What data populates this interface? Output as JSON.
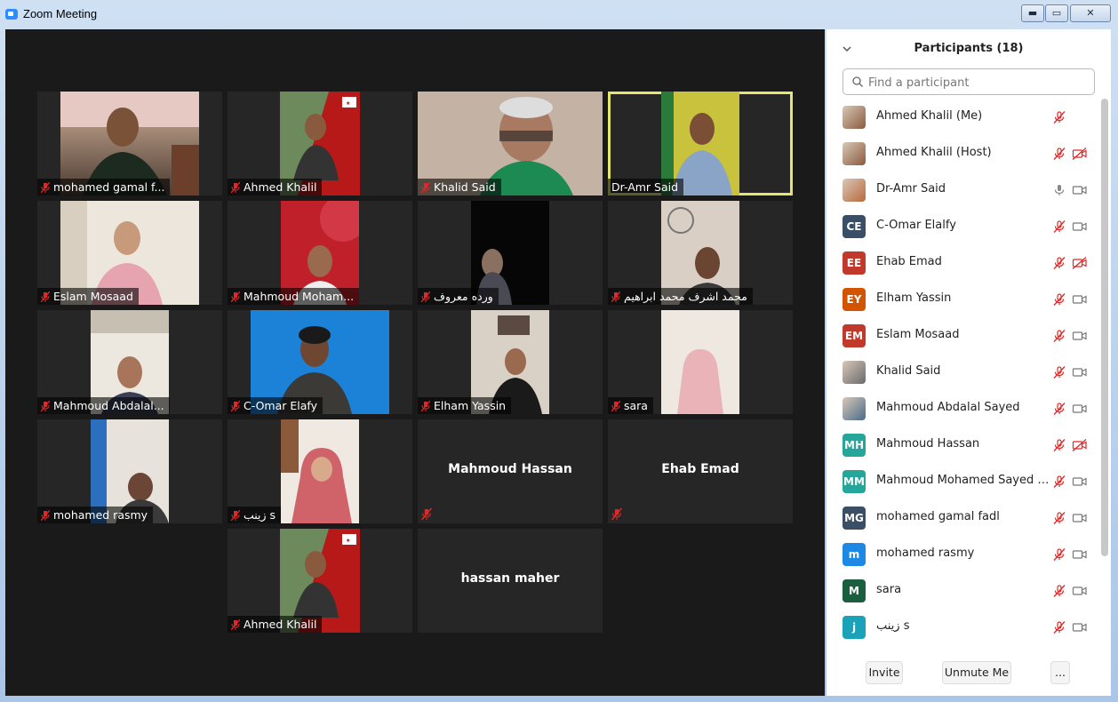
{
  "window": {
    "title": "Zoom Meeting",
    "minimize": "▬",
    "maximize": "▭",
    "close": "✕"
  },
  "gallery": {
    "tiles": [
      {
        "name": "mohamed gamal f...",
        "muted": true
      },
      {
        "name": "Ahmed Khalil",
        "muted": true
      },
      {
        "name": "Khalid Said",
        "muted": true
      },
      {
        "name": "Dr-Amr Said",
        "muted": false,
        "active": true
      },
      {
        "name": "Eslam Mosaad",
        "muted": true
      },
      {
        "name": "Mahmoud Moham...",
        "muted": true
      },
      {
        "name": "ورده معروف",
        "muted": true
      },
      {
        "name": "محمد اشرف محمد ابراهيم",
        "muted": true
      },
      {
        "name": "Mahmoud Abdalal...",
        "muted": true
      },
      {
        "name": "C-Omar Elafy",
        "muted": true
      },
      {
        "name": "Elham Yassin",
        "muted": true
      },
      {
        "name": "sara",
        "muted": true
      },
      {
        "name": "mohamed rasmy",
        "muted": true
      },
      {
        "name": "زينب s",
        "muted": true
      },
      {
        "name": "Mahmoud Hassan",
        "muted": true
      },
      {
        "name": "Ehab Emad",
        "muted": true
      },
      {
        "name": "Ahmed Khalil",
        "muted": true
      },
      {
        "name": "hassan maher",
        "muted": false
      }
    ]
  },
  "participants": {
    "title": "Participants (18)",
    "search_placeholder": "Find a participant",
    "list": [
      {
        "name": "Ahmed Khalil (Me)",
        "avatar": "",
        "mic": "muted",
        "cam": "none"
      },
      {
        "name": "Ahmed Khalil (Host)",
        "avatar": "",
        "mic": "muted",
        "cam": "off"
      },
      {
        "name": "Dr-Amr Said",
        "avatar": "",
        "mic": "on",
        "cam": "on"
      },
      {
        "name": "C-Omar Elalfy",
        "avatar": "CE",
        "mic": "muted",
        "cam": "on"
      },
      {
        "name": "Ehab Emad",
        "avatar": "EE",
        "mic": "muted",
        "cam": "off"
      },
      {
        "name": "Elham Yassin",
        "avatar": "EY",
        "mic": "muted",
        "cam": "on"
      },
      {
        "name": "Eslam Mosaad",
        "avatar": "EM",
        "mic": "muted",
        "cam": "on"
      },
      {
        "name": "Khalid Said",
        "avatar": "",
        "mic": "muted",
        "cam": "on"
      },
      {
        "name": "Mahmoud Abdalal Sayed",
        "avatar": "",
        "mic": "muted",
        "cam": "on"
      },
      {
        "name": "Mahmoud Hassan",
        "avatar": "MH",
        "mic": "muted",
        "cam": "off"
      },
      {
        "name": "Mahmoud Mohamed Sayed He...",
        "avatar": "MM",
        "mic": "muted",
        "cam": "on"
      },
      {
        "name": "mohamed gamal fadl",
        "avatar": "MG",
        "mic": "muted",
        "cam": "on"
      },
      {
        "name": "mohamed rasmy",
        "avatar": "m",
        "mic": "muted",
        "cam": "on"
      },
      {
        "name": "sara",
        "avatar": "M",
        "mic": "muted",
        "cam": "on"
      },
      {
        "name": "زينب s",
        "avatar": "j",
        "mic": "muted",
        "cam": "on"
      }
    ],
    "footer": {
      "invite": "Invite",
      "unmute": "Unmute Me",
      "more": "..."
    }
  },
  "colors": {
    "gallery_bg": "#1a1a1a",
    "tile_bg": "#262626",
    "active_speaker": "#e4e670",
    "muted_red": "#e02828",
    "avatar_colors": {
      "CE": "#3a4f66",
      "EE": "#c0392b",
      "EY": "#d35400",
      "EM": "#c0392b",
      "MH": "#26a69a",
      "MM": "#26a69a",
      "MG": "#3a4f66",
      "m": "#1e88e5",
      "M": "#1b5e40",
      "j": "#1aa3b8"
    }
  }
}
